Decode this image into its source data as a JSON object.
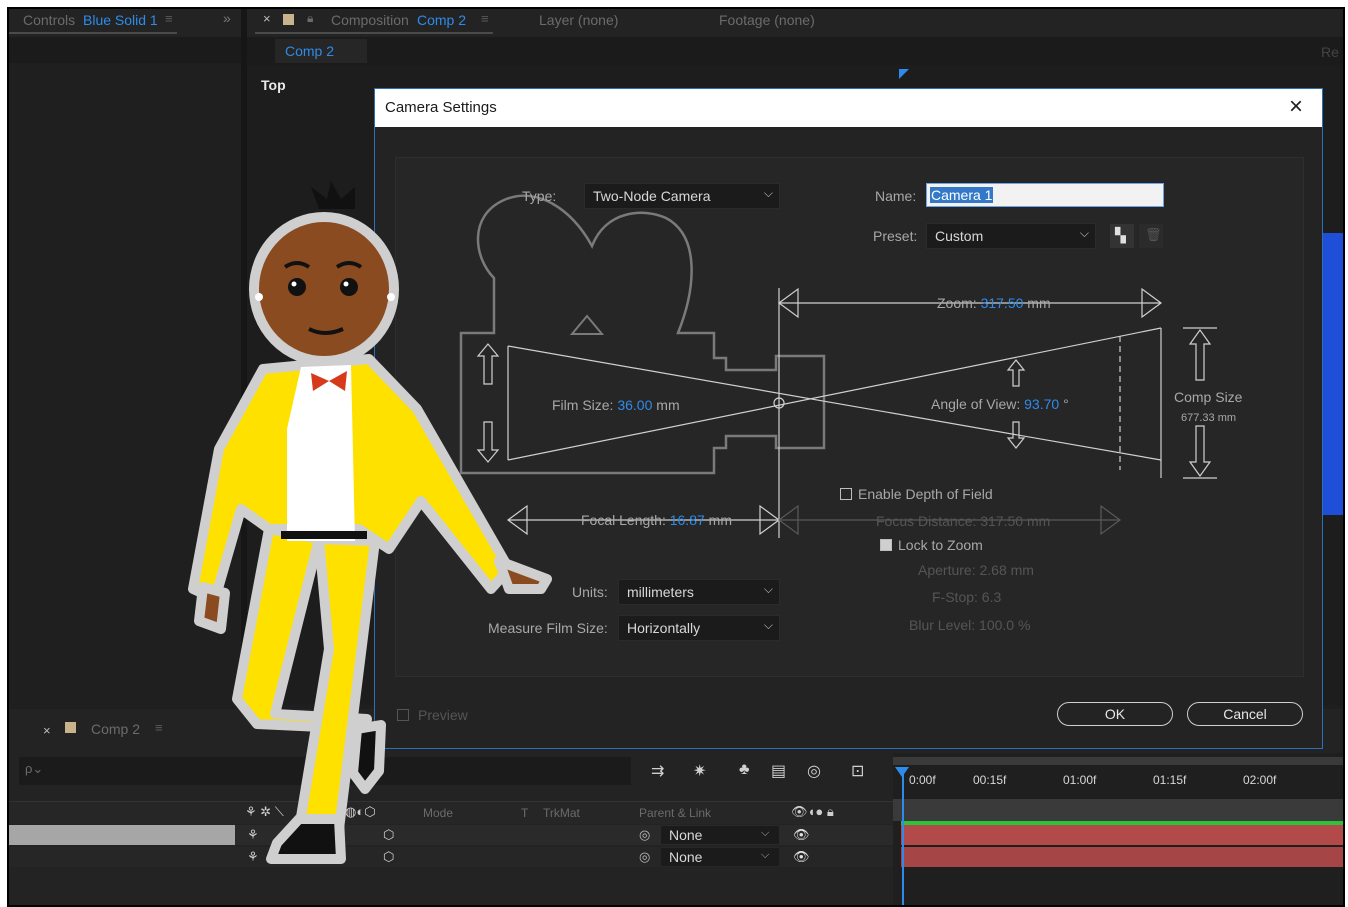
{
  "left_panel": {
    "title": "Controls",
    "layer": "Blue Solid 1",
    "expand": "»"
  },
  "comp_panel": {
    "close": "×",
    "title": "Composition",
    "comp_name": "Comp 2",
    "layer_tab": "Layer",
    "layer_value": "(none)",
    "footage_tab": "Footage",
    "footage_value": "(none)",
    "sub_tab": "Comp 2",
    "view_label": "Top",
    "right_edge": "Re"
  },
  "dialog": {
    "title": "Camera Settings",
    "close": "×",
    "type_label": "Type:",
    "type_value": "Two-Node Camera",
    "name_label": "Name:",
    "name_value": "Camera 1",
    "preset_label": "Preset:",
    "preset_value": "Custom",
    "zoom_label": "Zoom:",
    "zoom_value": "317.50",
    "zoom_unit": "mm",
    "film_size_label": "Film Size:",
    "film_size_value": "36.00",
    "film_size_unit": "mm",
    "aov_label": "Angle of View:",
    "aov_value": "93.70",
    "aov_unit": "°",
    "comp_size_label": "Comp Size",
    "comp_size_value": "677.33 mm",
    "focal_label": "Focal Length:",
    "focal_value": "16.87",
    "focal_unit": "mm",
    "dof_label": "Enable Depth of Field",
    "focus_label": "Focus Distance:",
    "focus_value": "317.50 mm",
    "lock_label": "Lock to Zoom",
    "aperture_label": "Aperture:",
    "aperture_value": "2.68 mm",
    "fstop_label": "F-Stop:",
    "fstop_value": "6.3",
    "blur_label": "Blur Level:",
    "blur_value": "100.0 %",
    "units_label": "Units:",
    "units_value": "millimeters",
    "measure_label": "Measure Film Size:",
    "measure_value": "Horizontally",
    "preview_label": "Preview",
    "ok_label": "OK",
    "cancel_label": "Cancel"
  },
  "timeline": {
    "close": "×",
    "comp_tab": "Comp 2",
    "search_placeholder": "ρ⌄",
    "mode_header": "Mode",
    "t_header": "T",
    "trkmat_header": "TrkMat",
    "parent_header": "Parent & Link",
    "ruler": [
      "0:00f",
      "00:15f",
      "01:00f",
      "01:15f",
      "02:00f"
    ],
    "rows": [
      {
        "parent": "None"
      },
      {
        "parent": "None"
      }
    ]
  },
  "colors": {
    "accent_blue": "#2d8ceb",
    "layer_bar": "#b34a4a",
    "character_suit": "#ffe100"
  }
}
